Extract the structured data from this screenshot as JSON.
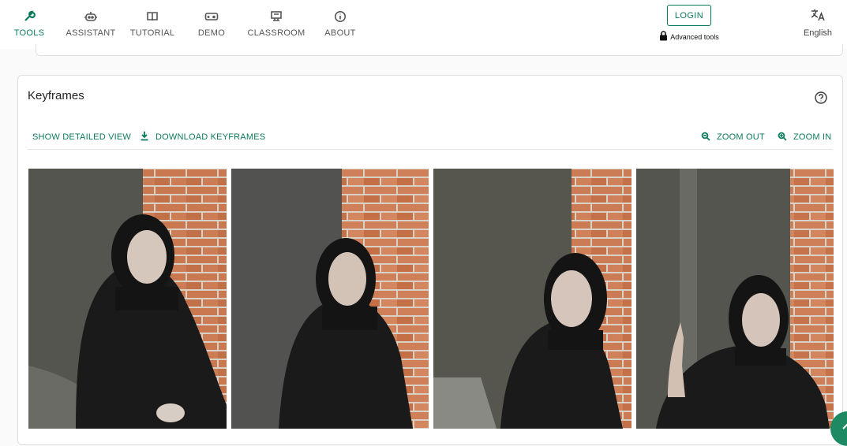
{
  "nav": {
    "items": [
      {
        "id": "tools",
        "label": "TOOLS",
        "icon": "wrench-icon",
        "active": true
      },
      {
        "id": "assistant",
        "label": "ASSISTANT",
        "icon": "robot-icon"
      },
      {
        "id": "tutorial",
        "label": "TUTORIAL",
        "icon": "book-icon"
      },
      {
        "id": "demo",
        "label": "DEMO",
        "icon": "gamepad-icon"
      },
      {
        "id": "classroom",
        "label": "CLASSROOM",
        "icon": "classroom-icon"
      },
      {
        "id": "about",
        "label": "ABOUT",
        "icon": "info-icon"
      }
    ],
    "login_label": "LOGIN",
    "advanced_tools_label": "Advanced tools",
    "language_label": "English"
  },
  "keyframes": {
    "title": "Keyframes",
    "show_detailed_label": "SHOW DETAILED VIEW",
    "download_label": "DOWNLOAD KEYFRAMES",
    "zoom_out_label": "ZOOM OUT",
    "zoom_in_label": "ZOOM IN",
    "frames": [
      {
        "name": "keyframe-1"
      },
      {
        "name": "keyframe-2"
      },
      {
        "name": "keyframe-3"
      },
      {
        "name": "keyframe-4"
      }
    ]
  },
  "colors": {
    "accent": "#0b7a5c",
    "fab": "#1e8a63",
    "brick": "#c9784f",
    "wall": "#4a4a48",
    "clothing": "#1a1a1a"
  }
}
